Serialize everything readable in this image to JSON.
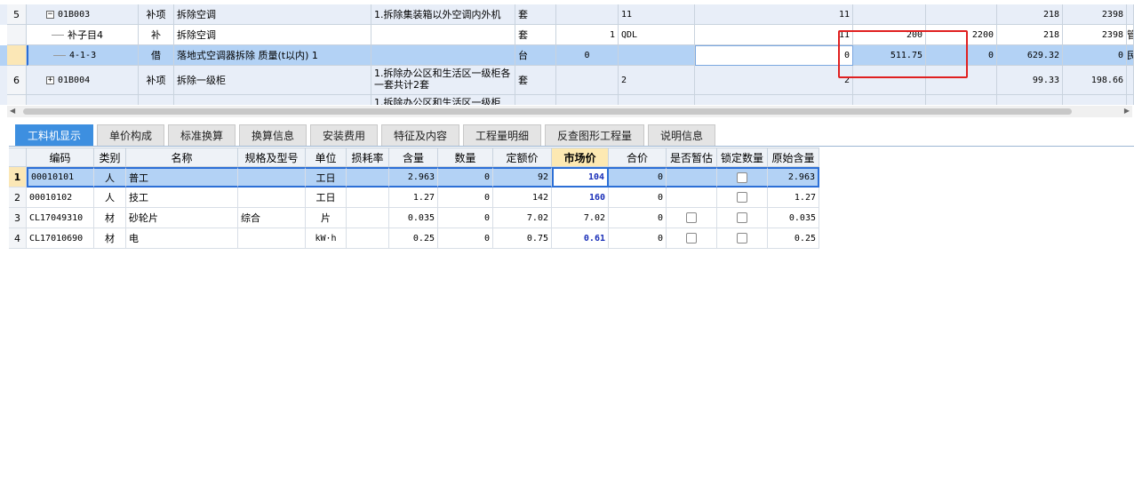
{
  "top_rows": [
    {
      "num": "5",
      "code": "01B003",
      "type": "补项",
      "name": "拆除空调",
      "feature": "1.拆除集装箱以外空调内外机",
      "unit": "套",
      "c1": "",
      "c2": "11",
      "c3": "11",
      "c4": "",
      "c5": "",
      "c6": "218",
      "c7": "2398",
      "c8": ""
    },
    {
      "num": "",
      "code": "补子目4",
      "type": "补",
      "name": "拆除空调",
      "feature": "",
      "unit": "套",
      "c1": "1",
      "c2": "QDL",
      "c3": "11",
      "c4": "200",
      "c5": "2200",
      "c6": "218",
      "c7": "2398",
      "c8": "管"
    },
    {
      "num": "",
      "code": "4-1-3",
      "type": "借",
      "name": "落地式空调器拆除 质量(t以内) 1",
      "feature": "",
      "unit": "台",
      "c1": "0",
      "c2": "",
      "c3": "0",
      "c4": "511.75",
      "c5": "0",
      "c6": "629.32",
      "c7": "0",
      "c8": "民"
    },
    {
      "num": "6",
      "code": "01B004",
      "type": "补项",
      "name": "拆除一级柜",
      "feature": "1.拆除办公区和生活区一级柜各一套共计2套",
      "unit": "套",
      "c1": "",
      "c2": "2",
      "c3": "2",
      "c4": "",
      "c5": "",
      "c6": "99.33",
      "c7": "198.66",
      "c8": ""
    },
    {
      "num": "",
      "code": "",
      "type": "",
      "name": "",
      "feature": "1.拆除办公区和生活区一级柜",
      "unit": "",
      "c1": "",
      "c2": "",
      "c3": "",
      "c4": "",
      "c5": "",
      "c6": "",
      "c7": "",
      "c8": ""
    }
  ],
  "tabs": [
    "工料机显示",
    "单价构成",
    "标准换算",
    "换算信息",
    "安装费用",
    "特征及内容",
    "工程量明细",
    "反查图形工程量",
    "说明信息"
  ],
  "columns": [
    "编码",
    "类别",
    "名称",
    "规格及型号",
    "单位",
    "损耗率",
    "含量",
    "数量",
    "定额价",
    "市场价",
    "合价",
    "是否暂估",
    "锁定数量",
    "原始含量"
  ],
  "rows": [
    {
      "n": "1",
      "code": "00010101",
      "cat": "人",
      "name": "普工",
      "spec": "",
      "unit": "工日",
      "loss": "",
      "qty": "2.963",
      "amount": "0",
      "base": "92",
      "market": "104",
      "total": "0",
      "temp": false,
      "lock": true,
      "orig": "2.963"
    },
    {
      "n": "2",
      "code": "00010102",
      "cat": "人",
      "name": "技工",
      "spec": "",
      "unit": "工日",
      "loss": "",
      "qty": "1.27",
      "amount": "0",
      "base": "142",
      "market": "160",
      "total": "0",
      "temp": false,
      "lock": true,
      "orig": "1.27"
    },
    {
      "n": "3",
      "code": "CL17049310",
      "cat": "材",
      "name": "砂轮片",
      "spec": "综合",
      "unit": "片",
      "loss": "",
      "qty": "0.035",
      "amount": "0",
      "base": "7.02",
      "market": "7.02",
      "total": "0",
      "temp": true,
      "lock": true,
      "orig": "0.035"
    },
    {
      "n": "4",
      "code": "CL17010690",
      "cat": "材",
      "name": "电",
      "spec": "",
      "unit": "kW·h",
      "loss": "",
      "qty": "0.25",
      "amount": "0",
      "base": "0.75",
      "market": "0.61",
      "total": "0",
      "temp": true,
      "lock": true,
      "orig": "0.25"
    }
  ],
  "highlight_color": "#e02020",
  "tab_active_color": "#3d8fe0"
}
